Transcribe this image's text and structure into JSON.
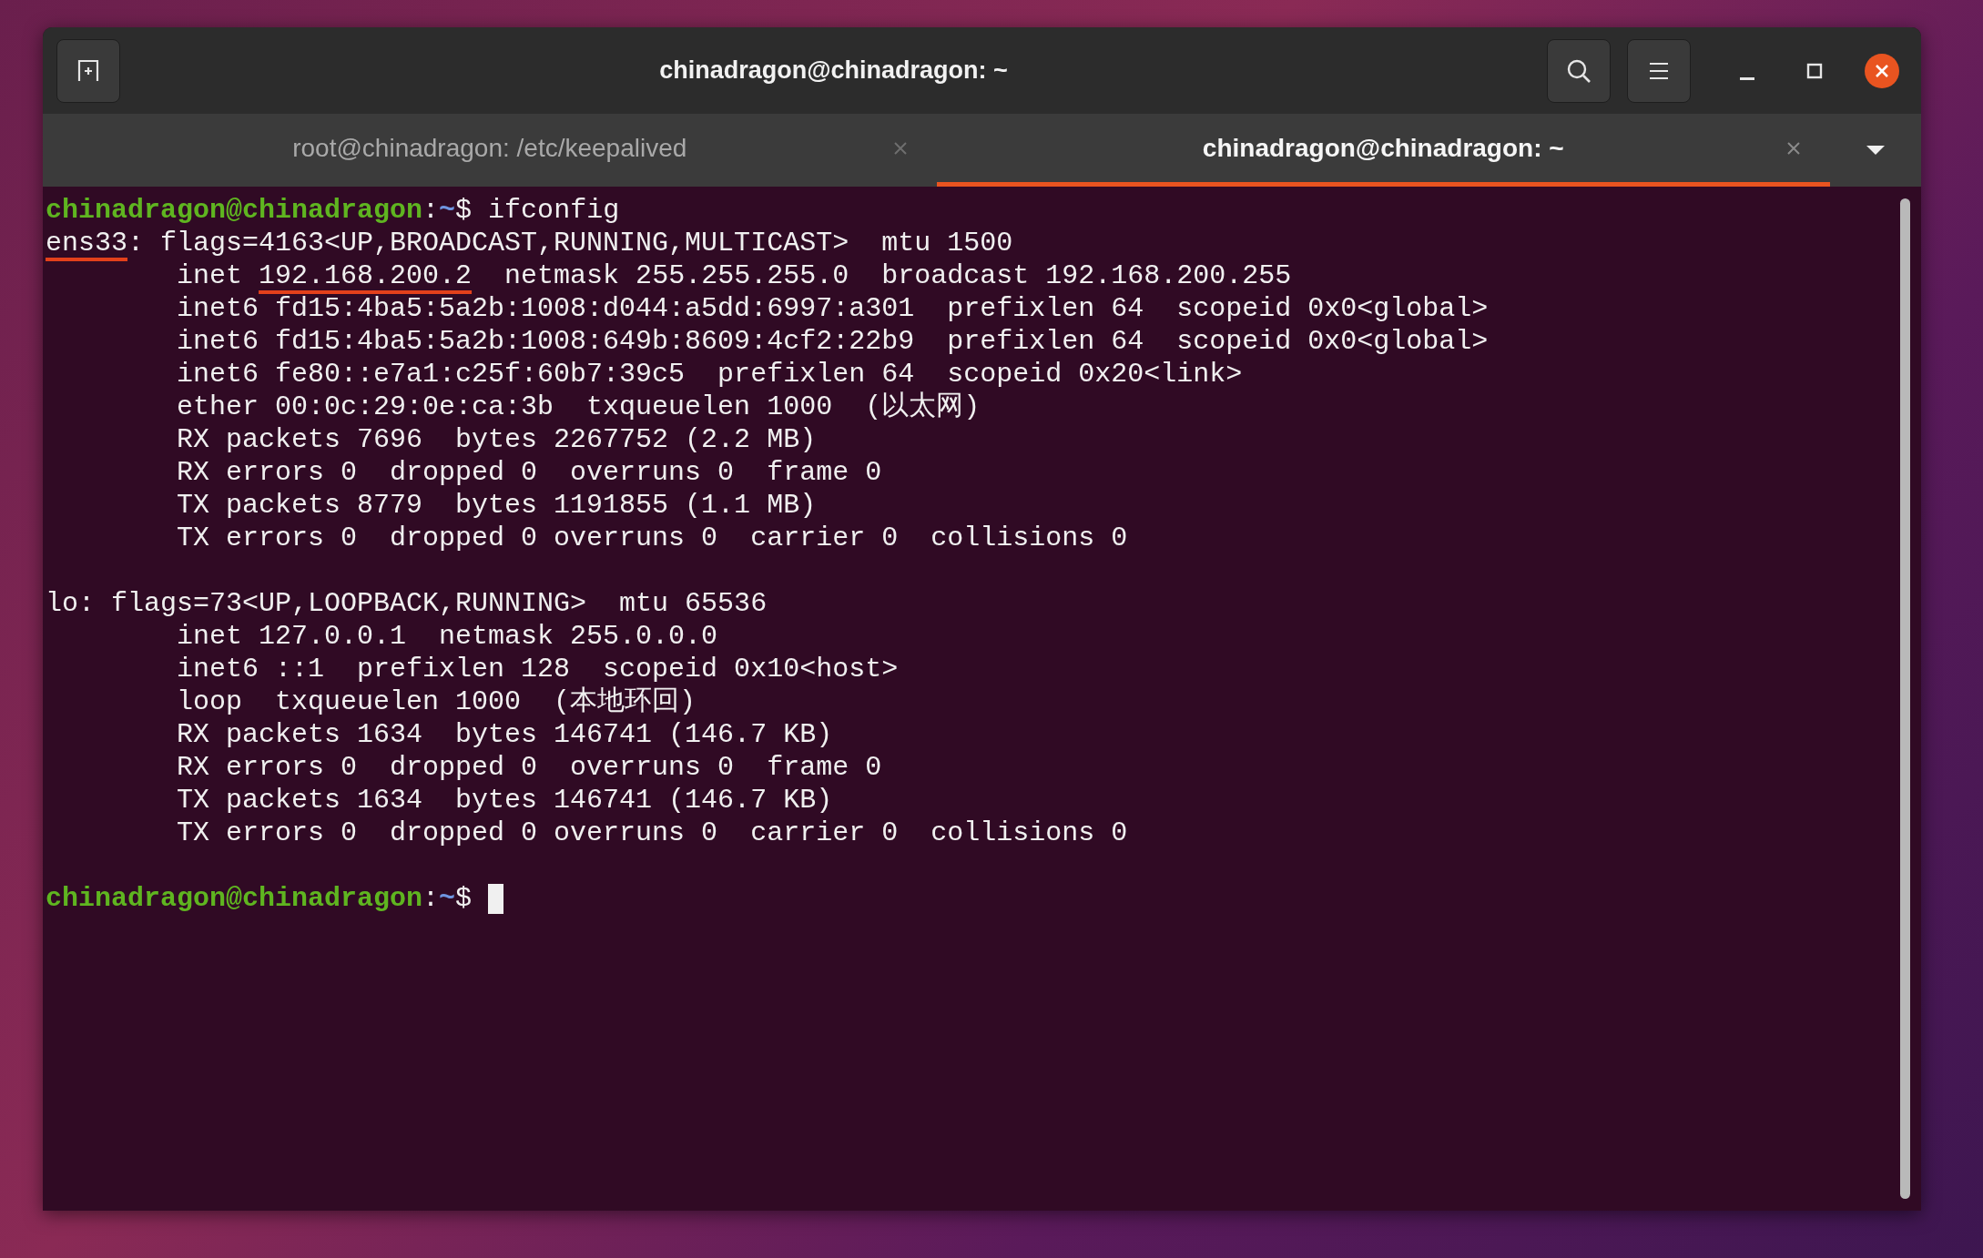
{
  "window": {
    "title": "chinadragon@chinadragon: ~"
  },
  "tabs": [
    {
      "label": "root@chinadragon: /etc/keepalived",
      "selected": false
    },
    {
      "label": "chinadragon@chinadragon: ~",
      "selected": true
    }
  ],
  "terminal": {
    "lines": [
      {
        "segments": [
          {
            "kind": "user",
            "text": "chinadragon@chinadragon"
          },
          {
            "kind": "plain",
            "text": ":"
          },
          {
            "kind": "path",
            "text": "~"
          },
          {
            "kind": "plain",
            "text": "$ ifconfig"
          }
        ]
      },
      {
        "segments": [
          {
            "kind": "underlined",
            "text": "ens33"
          },
          {
            "kind": "plain",
            "text": ": flags=4163<UP,BROADCAST,RUNNING,MULTICAST>  mtu 1500"
          }
        ]
      },
      {
        "segments": [
          {
            "kind": "plain",
            "text": "        inet "
          },
          {
            "kind": "underlined",
            "text": "192.168.200.2"
          },
          {
            "kind": "plain",
            "text": "  netmask 255.255.255.0  broadcast 192.168.200.255"
          }
        ]
      },
      {
        "segments": [
          {
            "kind": "plain",
            "text": "        inet6 fd15:4ba5:5a2b:1008:d044:a5dd:6997:a301  prefixlen 64  scopeid 0x0<global>"
          }
        ]
      },
      {
        "segments": [
          {
            "kind": "plain",
            "text": "        inet6 fd15:4ba5:5a2b:1008:649b:8609:4cf2:22b9  prefixlen 64  scopeid 0x0<global>"
          }
        ]
      },
      {
        "segments": [
          {
            "kind": "plain",
            "text": "        inet6 fe80::e7a1:c25f:60b7:39c5  prefixlen 64  scopeid 0x20<link>"
          }
        ]
      },
      {
        "segments": [
          {
            "kind": "plain",
            "text": "        ether 00:0c:29:0e:ca:3b  txqueuelen 1000  (以太网)"
          }
        ]
      },
      {
        "segments": [
          {
            "kind": "plain",
            "text": "        RX packets 7696  bytes 2267752 (2.2 MB)"
          }
        ]
      },
      {
        "segments": [
          {
            "kind": "plain",
            "text": "        RX errors 0  dropped 0  overruns 0  frame 0"
          }
        ]
      },
      {
        "segments": [
          {
            "kind": "plain",
            "text": "        TX packets 8779  bytes 1191855 (1.1 MB)"
          }
        ]
      },
      {
        "segments": [
          {
            "kind": "plain",
            "text": "        TX errors 0  dropped 0 overruns 0  carrier 0  collisions 0"
          }
        ]
      },
      {
        "blank_before": true,
        "segments": [
          {
            "kind": "plain",
            "text": "lo: flags=73<UP,LOOPBACK,RUNNING>  mtu 65536"
          }
        ]
      },
      {
        "segments": [
          {
            "kind": "plain",
            "text": "        inet 127.0.0.1  netmask 255.0.0.0"
          }
        ]
      },
      {
        "segments": [
          {
            "kind": "plain",
            "text": "        inet6 ::1  prefixlen 128  scopeid 0x10<host>"
          }
        ]
      },
      {
        "segments": [
          {
            "kind": "plain",
            "text": "        loop  txqueuelen 1000  (本地环回)"
          }
        ]
      },
      {
        "segments": [
          {
            "kind": "plain",
            "text": "        RX packets 1634  bytes 146741 (146.7 KB)"
          }
        ]
      },
      {
        "segments": [
          {
            "kind": "plain",
            "text": "        RX errors 0  dropped 0  overruns 0  frame 0"
          }
        ]
      },
      {
        "segments": [
          {
            "kind": "plain",
            "text": "        TX packets 1634  bytes 146741 (146.7 KB)"
          }
        ]
      },
      {
        "segments": [
          {
            "kind": "plain",
            "text": "        TX errors 0  dropped 0 overruns 0  carrier 0  collisions 0"
          }
        ]
      },
      {
        "blank_before": true,
        "cursor": true,
        "segments": [
          {
            "kind": "user",
            "text": "chinadragon@chinadragon"
          },
          {
            "kind": "plain",
            "text": ":"
          },
          {
            "kind": "path",
            "text": "~"
          },
          {
            "kind": "plain",
            "text": "$ "
          }
        ]
      }
    ]
  }
}
